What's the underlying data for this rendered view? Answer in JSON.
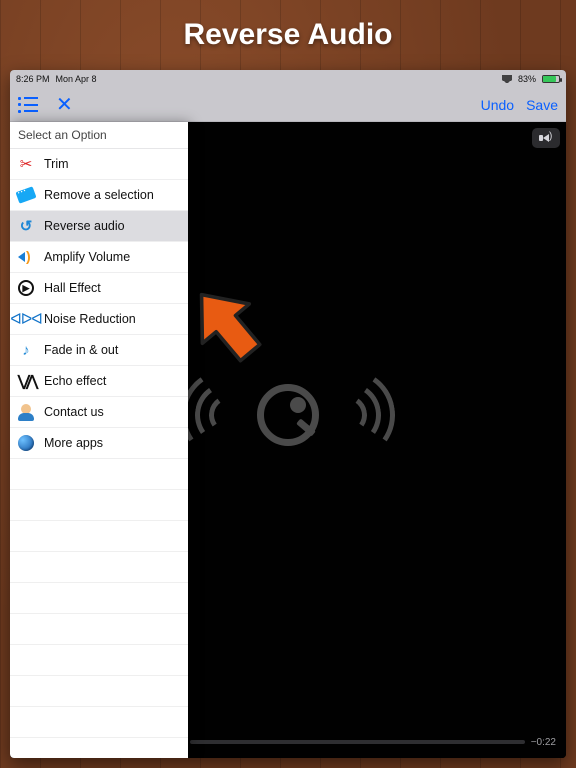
{
  "banner": {
    "title": "Reverse Audio"
  },
  "statusbar": {
    "time": "8:26 PM",
    "date": "Mon Apr 8",
    "battery_pct": "83%"
  },
  "toolbar": {
    "undo_label": "Undo",
    "save_label": "Save"
  },
  "popover": {
    "header": "Select an Option",
    "items": [
      {
        "label": "Trim",
        "icon": "scissors-icon"
      },
      {
        "label": "Remove a selection",
        "icon": "tag-icon"
      },
      {
        "label": "Reverse audio",
        "icon": "undo-icon",
        "selected": true
      },
      {
        "label": "Amplify Volume",
        "icon": "speaker-icon"
      },
      {
        "label": "Hall Effect",
        "icon": "hall-icon"
      },
      {
        "label": "Noise Reduction",
        "icon": "noise-icon"
      },
      {
        "label": "Fade in & out",
        "icon": "fade-icon"
      },
      {
        "label": "Echo effect",
        "icon": "echo-icon"
      },
      {
        "label": "Contact us",
        "icon": "contact-icon"
      },
      {
        "label": "More apps",
        "icon": "globe-icon"
      }
    ]
  },
  "player": {
    "remaining_time": "−0:22"
  }
}
